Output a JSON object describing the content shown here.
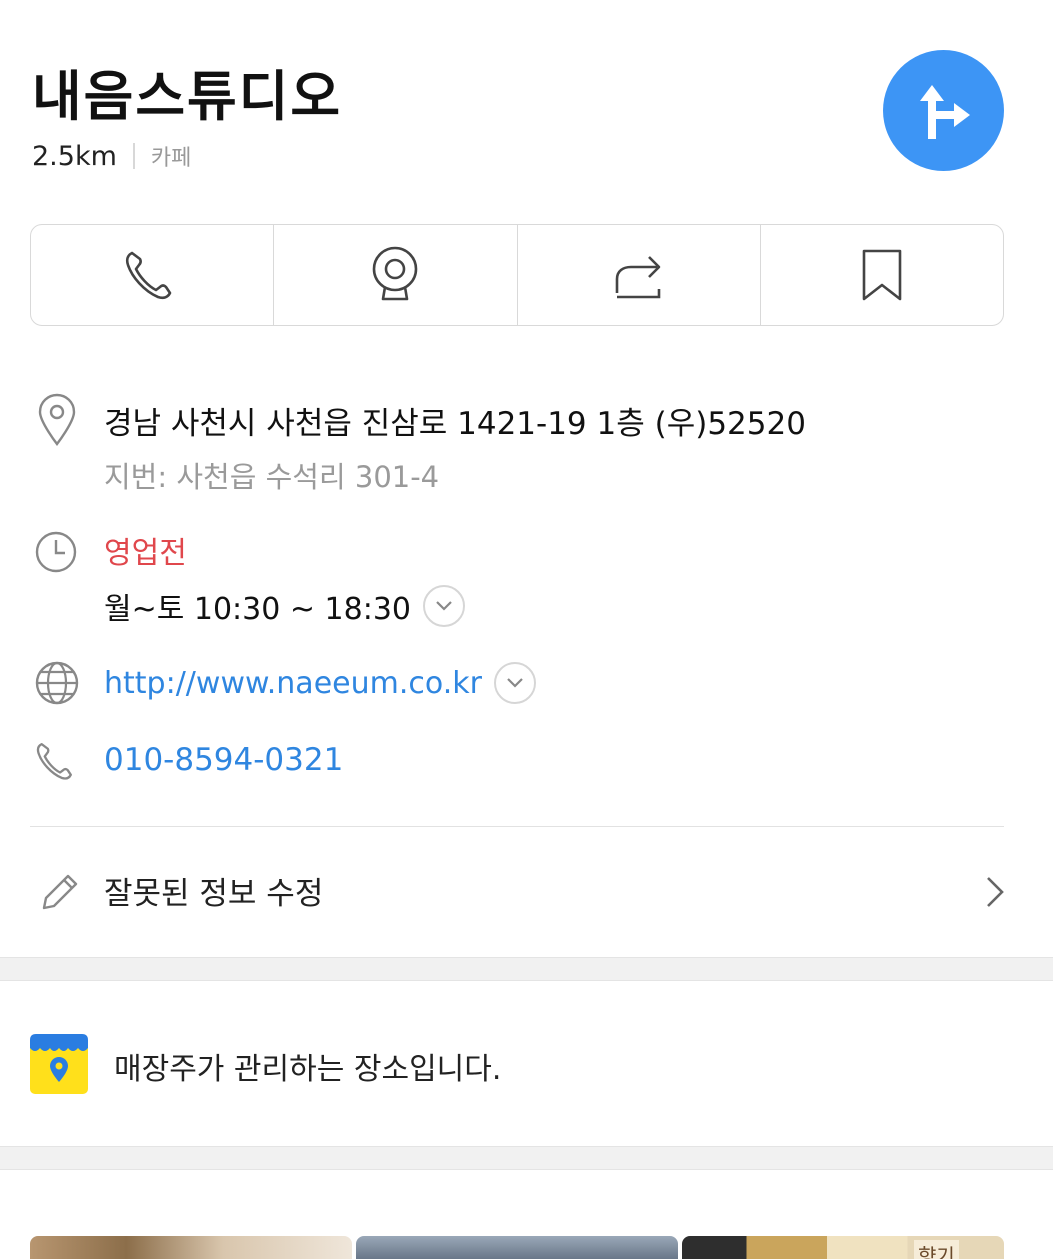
{
  "place": {
    "name": "내음스튜디오",
    "distance": "2.5km",
    "category": "카페"
  },
  "icons": {
    "route": "directions-icon",
    "call": "phone-icon",
    "roadview": "roadview-camera-icon",
    "share": "share-icon",
    "save": "bookmark-icon",
    "location": "location-pin-icon",
    "clock": "clock-icon",
    "globe": "globe-icon",
    "phone": "phone-icon",
    "edit": "pencil-icon",
    "chevron_right": "chevron-right-icon",
    "chevron_down": "chevron-down-icon",
    "store": "store-owner-icon"
  },
  "info": {
    "address": "경남 사천시 사천읍 진삼로 1421-19 1층 (우)52520",
    "lot_address": "지번: 사천읍 수석리 301-4",
    "status": "영업전",
    "hours": "월~토 10:30 ~ 18:30",
    "website": "http://www.naeeum.co.kr",
    "phone": "010-8594-0321"
  },
  "edit": {
    "label": "잘못된 정보 수정"
  },
  "owner": {
    "label": "매장주가 관리하는 장소입니다."
  },
  "photos": {
    "sign_text": "향기"
  },
  "colors": {
    "accent": "#3d95f5",
    "link": "#2f86e0",
    "status_closed": "#e0474c",
    "store_yellow": "#ffe01b",
    "store_blue": "#2a7de1"
  }
}
